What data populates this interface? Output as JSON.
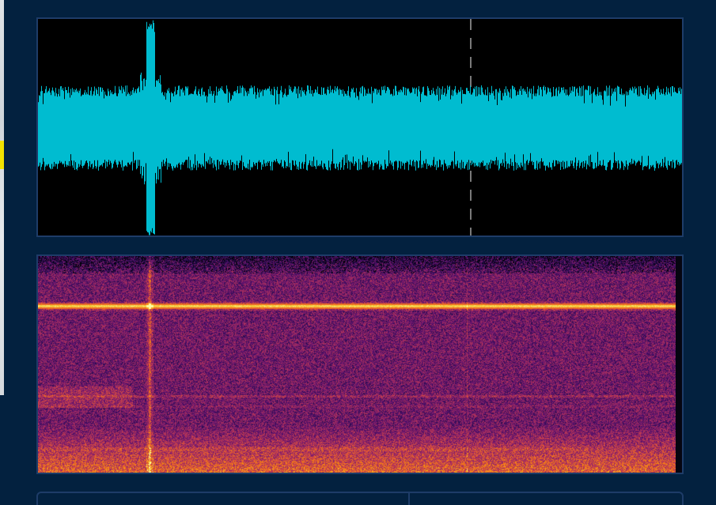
{
  "view": {
    "background": "#03213f",
    "panel_border": "#1e3c68"
  },
  "waveform": {
    "color": "#00bcd0",
    "background": "#000000",
    "transient_position": 0.175,
    "playhead_position": 0.672
  },
  "spectrogram": {
    "colormap": "inferno",
    "tone_band_position": 0.23,
    "transient_position": 0.175,
    "playhead_position": 0.672
  },
  "info_bar": {
    "left_text": "",
    "right_text": ""
  }
}
